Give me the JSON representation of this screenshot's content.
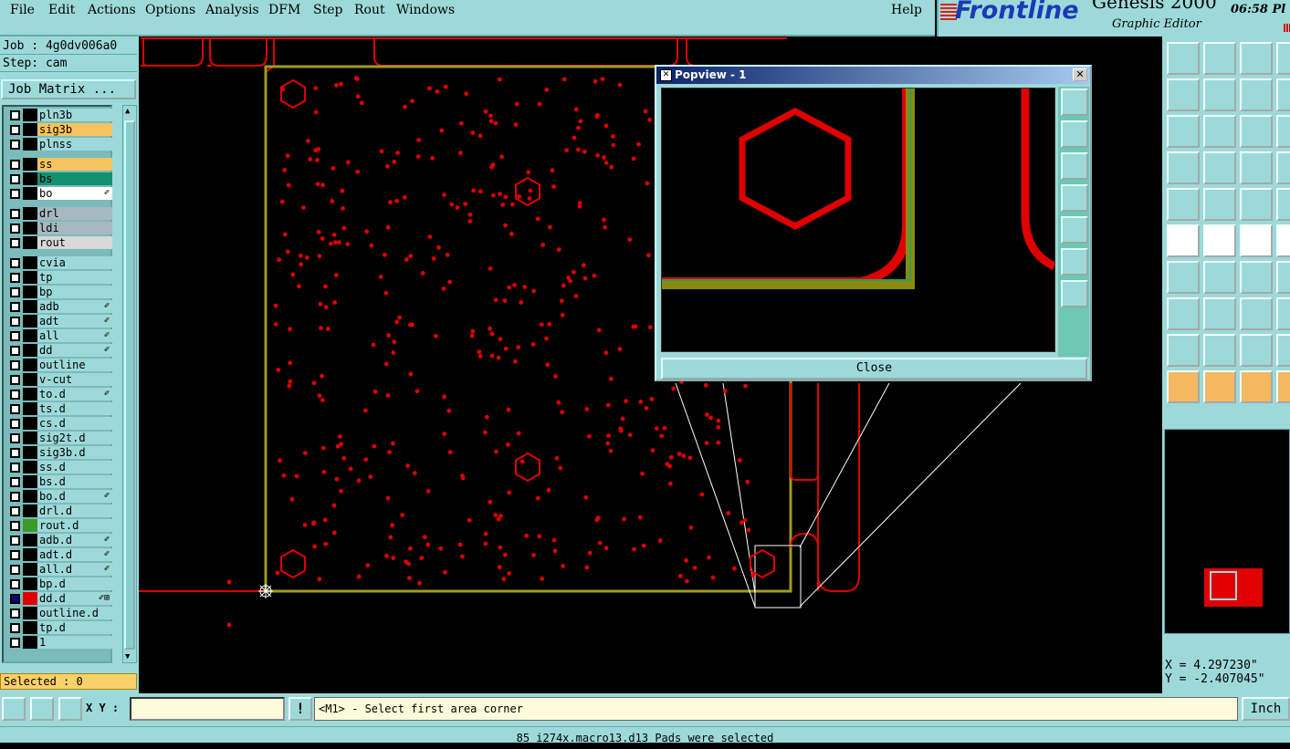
{
  "menu": {
    "items": [
      "File",
      "Edit",
      "Actions",
      "Options",
      "Analysis",
      "DFM",
      "Step",
      "Rout",
      "Windows"
    ],
    "help": "Help"
  },
  "brand": {
    "logo": "Frontline",
    "product": "Genesis 2000",
    "subtitle": "Graphic Editor",
    "time": "06:58 Pl"
  },
  "job": {
    "job_label": "Job : 4g0dv006a0",
    "step_label": "Step: cam",
    "matrix_button": "Job Matrix ..."
  },
  "layers": [
    {
      "name": "pln3b",
      "color": "#9ed9d9",
      "swatch": "#000"
    },
    {
      "name": "sig3b",
      "color": "#f6c45e",
      "swatch": "#000"
    },
    {
      "name": "plnss",
      "color": "#9ed9d9",
      "swatch": "#000"
    },
    {
      "name": "ss",
      "color": "#f6c45e",
      "swatch": "#000"
    },
    {
      "name": "bs",
      "color": "#119070",
      "swatch": "#000"
    },
    {
      "name": "bo",
      "color": "#ffffff",
      "swatch": "#000",
      "icon": "✐"
    },
    {
      "name": "drl",
      "color": "#a8b8c0",
      "swatch": "#000"
    },
    {
      "name": "ldi",
      "color": "#a8b8c0",
      "swatch": "#000"
    },
    {
      "name": "rout",
      "color": "#d8d8d8",
      "swatch": "#000"
    },
    {
      "name": "cvia",
      "color": "#9ed9d9",
      "swatch": "#000"
    },
    {
      "name": "tp",
      "color": "#9ed9d9",
      "swatch": "#000"
    },
    {
      "name": "bp",
      "color": "#9ed9d9",
      "swatch": "#000"
    },
    {
      "name": "adb",
      "color": "#9ed9d9",
      "swatch": "#000",
      "icon": "✐"
    },
    {
      "name": "adt",
      "color": "#9ed9d9",
      "swatch": "#000",
      "icon": "✐"
    },
    {
      "name": "all",
      "color": "#9ed9d9",
      "swatch": "#000",
      "icon": "✐"
    },
    {
      "name": "dd",
      "color": "#9ed9d9",
      "swatch": "#000",
      "icon": "✐"
    },
    {
      "name": "outline",
      "color": "#9ed9d9",
      "swatch": "#000"
    },
    {
      "name": "v-cut",
      "color": "#9ed9d9",
      "swatch": "#000"
    },
    {
      "name": "to.d",
      "color": "#9ed9d9",
      "swatch": "#000",
      "icon": "✐"
    },
    {
      "name": "ts.d",
      "color": "#9ed9d9",
      "swatch": "#000"
    },
    {
      "name": "cs.d",
      "color": "#9ed9d9",
      "swatch": "#000"
    },
    {
      "name": "sig2t.d",
      "color": "#9ed9d9",
      "swatch": "#000"
    },
    {
      "name": "sig3b.d",
      "color": "#9ed9d9",
      "swatch": "#000"
    },
    {
      "name": "ss.d",
      "color": "#9ed9d9",
      "swatch": "#000"
    },
    {
      "name": "bs.d",
      "color": "#9ed9d9",
      "swatch": "#000"
    },
    {
      "name": "bo.d",
      "color": "#9ed9d9",
      "swatch": "#000",
      "icon": "✐"
    },
    {
      "name": "drl.d",
      "color": "#9ed9d9",
      "swatch": "#000"
    },
    {
      "name": "rout.d",
      "color": "#9ed9d9",
      "swatch": "#3a9a2a"
    },
    {
      "name": "adb.d",
      "color": "#9ed9d9",
      "swatch": "#000",
      "icon": "✐"
    },
    {
      "name": "adt.d",
      "color": "#9ed9d9",
      "swatch": "#000",
      "icon": "✐"
    },
    {
      "name": "all.d",
      "color": "#9ed9d9",
      "swatch": "#000",
      "icon": "✐"
    },
    {
      "name": "bp.d",
      "color": "#9ed9d9",
      "swatch": "#000"
    },
    {
      "name": "dd.d",
      "color": "#9ed9d9",
      "swatch": "#e00000",
      "icon": "✐⊞",
      "active": true
    },
    {
      "name": "outline.d",
      "color": "#9ed9d9",
      "swatch": "#000"
    },
    {
      "name": "tp.d",
      "color": "#9ed9d9",
      "swatch": "#000"
    },
    {
      "name": "1",
      "color": "#9ed9d9",
      "swatch": "#000"
    }
  ],
  "selected_label": "Selected : 0",
  "popview": {
    "title": "Popview - 1",
    "close": "Close",
    "close_x": "✕"
  },
  "coords": {
    "x": "X = 4.297230\"",
    "y": "Y = -2.407045\""
  },
  "bottom": {
    "xy_label": "X Y :",
    "xy_value": "",
    "warn": "!",
    "prompt": "<M1> - Select first area corner",
    "unit": "Inch"
  },
  "status": "85 i274x.macro13.d13 Pads were selected",
  "colors": {
    "pad": "#e00000",
    "profile": "#a09a20",
    "panel": "#9ed9d9",
    "selected": "#fad068"
  }
}
